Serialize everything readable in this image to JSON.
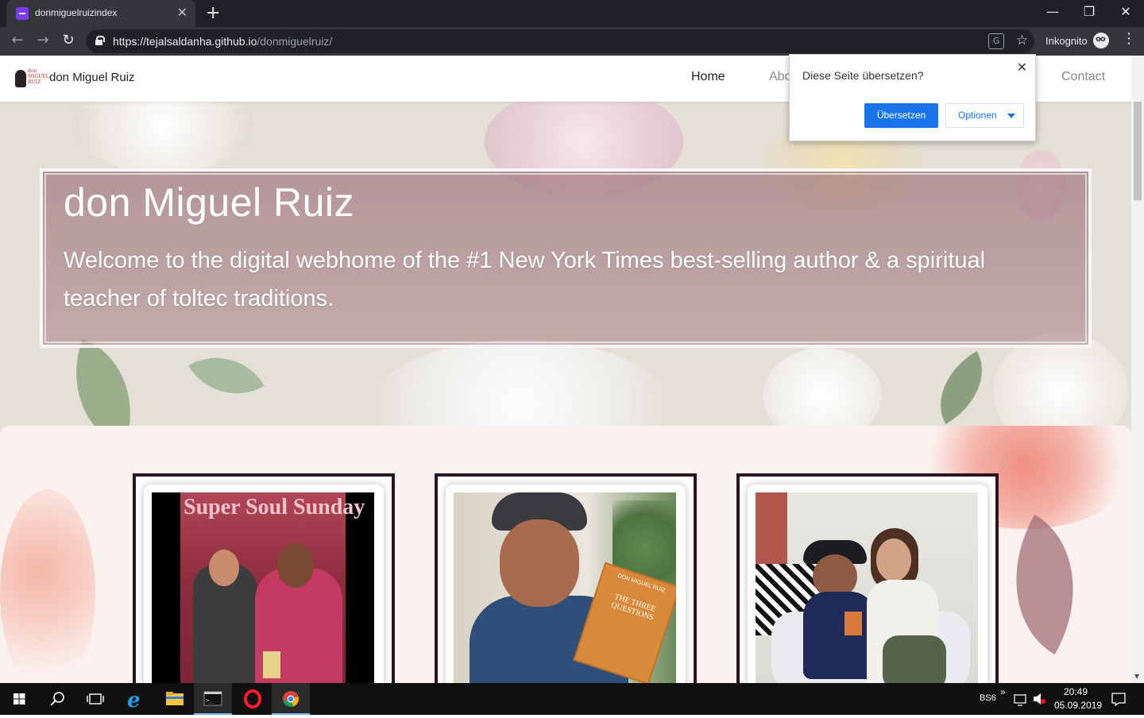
{
  "browser": {
    "tab_title": "donmiguelruizindex",
    "tab_close": "✕",
    "new_tab": "+",
    "url_host": "https://tejalsaldanha.github.io",
    "url_path": "/donmiguelruiz/",
    "incognito_label": "Inkognito",
    "win_minimize": "—",
    "win_restore": "❐",
    "win_close": "✕",
    "nav_back": "←",
    "nav_forward": "→",
    "nav_reload": "↻",
    "bookmark": "☆",
    "menu": "⋮"
  },
  "site": {
    "brand": "don Miguel Ruiz",
    "logo_text": "don MIGUEL RUIZ",
    "nav": {
      "home": "Home",
      "about": "Abo",
      "contact": "Contact"
    },
    "hero": {
      "title": "don Miguel Ruiz",
      "subtitle": "Welcome to the digital webhome of the #1 New York Times best-selling author & a spiritual teacher of toltec traditions."
    },
    "gallery": {
      "card1_sign": "Super Soul Sunday",
      "card2_book": "THE THREE QUESTIONS",
      "card2_author": "DON MIGUEL RUIZ"
    }
  },
  "translate_popup": {
    "message": "Diese Seite übersetzen?",
    "close": "✕",
    "translate_button": "Übersetzen",
    "options_button": "Optionen"
  },
  "taskbar": {
    "language": "BS6",
    "chevron": "»",
    "time": "20:49",
    "date": "05.09.2019"
  },
  "colors": {
    "chrome_dark": "#202124",
    "chrome_tab": "#35363a",
    "accent_blue": "#1a73e8",
    "hero_overlay": "#96697399",
    "card_border": "#2c1423"
  }
}
